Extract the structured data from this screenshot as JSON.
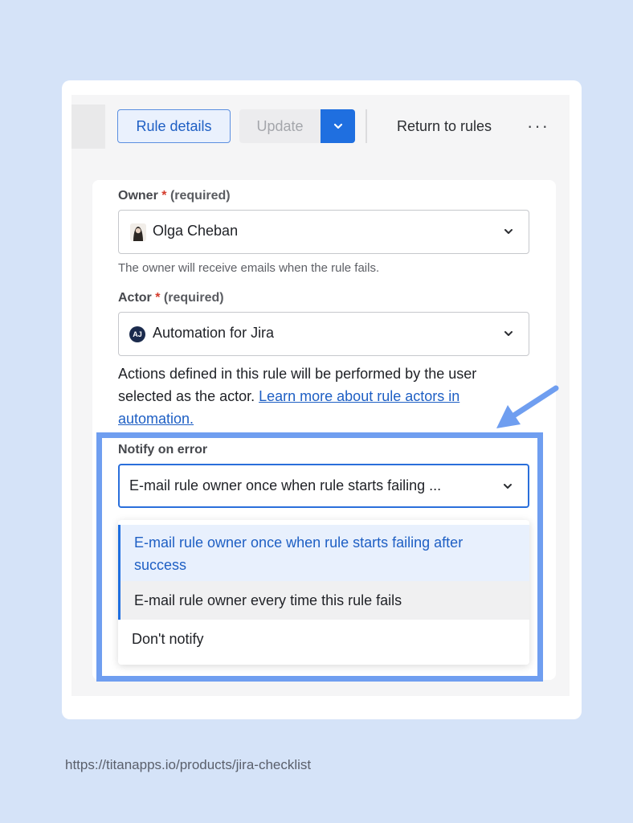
{
  "toolbar": {
    "rule_details_label": "Rule details",
    "update_label": "Update",
    "return_label": "Return to rules",
    "more_label": "···"
  },
  "owner": {
    "label": "Owner",
    "required_mark": "*",
    "required_text": "(required)",
    "value": "Olga Cheban",
    "helper": "The owner will receive emails when the rule fails."
  },
  "actor": {
    "label": "Actor",
    "required_mark": "*",
    "required_text": "(required)",
    "avatar_initials": "AJ",
    "value": "Automation for Jira",
    "description_prefix": "Actions defined in this rule will be performed by the user selected as the actor. ",
    "learn_more_link": "Learn more about rule actors in automation."
  },
  "notify": {
    "label": "Notify on error",
    "value": "E-mail rule owner once when rule starts failing ...",
    "options": [
      "E-mail rule owner once when rule starts failing after success",
      "E-mail rule owner every time this rule fails",
      "Don't notify"
    ]
  },
  "colors": {
    "accent": "#1f6fe0",
    "highlight_frame": "#6f9ef0",
    "background": "#d5e3f8"
  },
  "footer": {
    "url": "https://titanapps.io/products/jira-checklist"
  }
}
